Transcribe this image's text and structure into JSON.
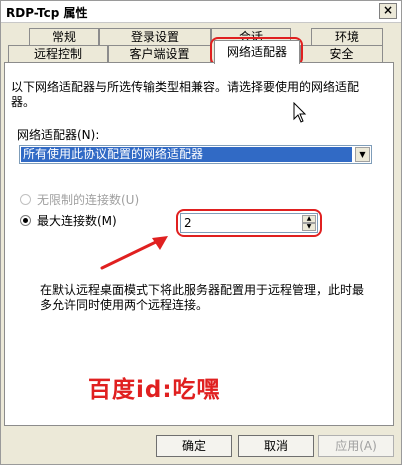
{
  "window": {
    "title": "RDP-Tcp 属性",
    "close_glyph": "×"
  },
  "tabs_top": [
    "常规",
    "登录设置",
    "会话",
    "环境"
  ],
  "tabs_bottom": [
    "远程控制",
    "客户端设置",
    "网络适配器",
    "安全"
  ],
  "active_tab": "网络适配器",
  "panel": {
    "description": "以下网络适配器与所选传输类型相兼容。请选择要使用的网络适配器。",
    "adapter_label": "网络适配器(N):",
    "adapter_selected": "所有使用此协议配置的网络适配器",
    "unlimited_label": "无限制的连接数(U)",
    "unlimited_selected": false,
    "unlimited_enabled": false,
    "max_label": "最大连接数(M)",
    "max_selected": true,
    "max_value": "2",
    "note": "在默认远程桌面模式下将此服务器配置用于远程管理，此时最多允许同时使用两个远程连接。"
  },
  "annotation": {
    "watermark": "百度id:吃嘿",
    "color": "#e02020"
  },
  "buttons": {
    "ok": "确定",
    "cancel": "取消",
    "apply": "应用(A)"
  },
  "colors": {
    "selection": "#316ac5",
    "dialog_bg": "#ece9d8"
  },
  "icons": [
    "close-icon",
    "dropdown-arrow-icon",
    "spin-up-icon",
    "spin-down-icon",
    "mouse-cursor-icon",
    "red-arrow-icon"
  ]
}
